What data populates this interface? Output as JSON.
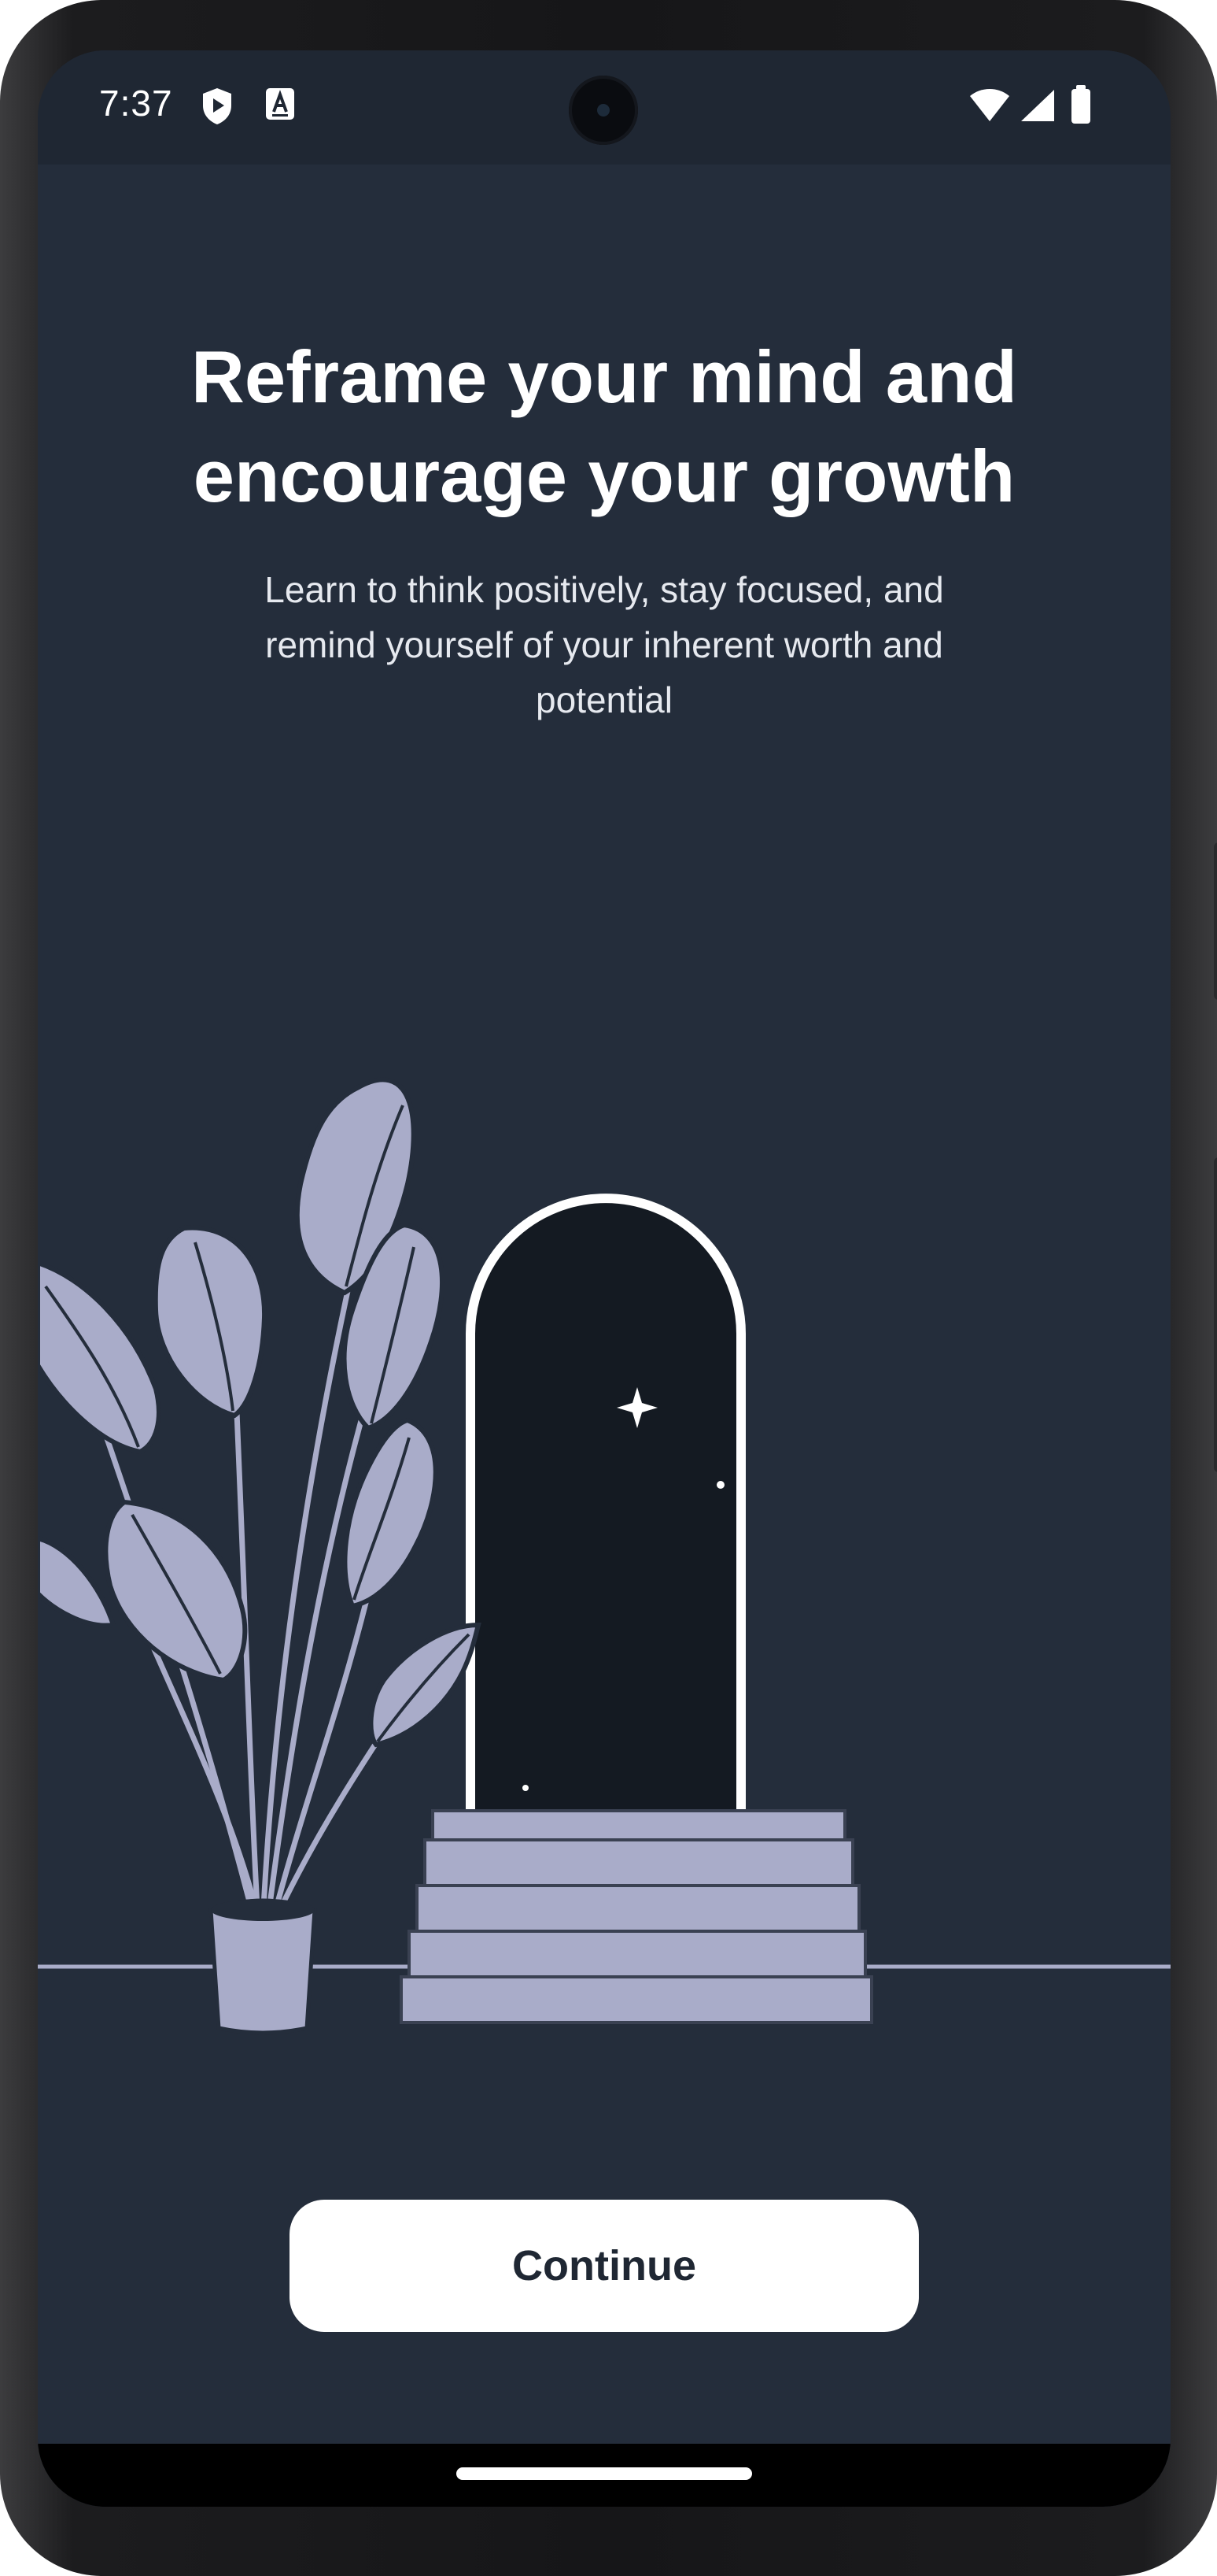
{
  "status_bar": {
    "time": "7:37",
    "left_icons": [
      "play-protect-icon",
      "accessibility-a-icon"
    ],
    "right_icons": [
      "wifi-icon",
      "cell-signal-icon",
      "battery-icon"
    ]
  },
  "onboarding": {
    "title": "Reframe your mind and encourage your growth",
    "subtitle": "Learn to think positively, stay focused, and remind yourself of your inherent worth and potential",
    "illustration": "plant-and-doorway-illustration",
    "continue_label": "Continue"
  },
  "colors": {
    "background": "#242d3b",
    "status_bar": "#1f2733",
    "illustration_fill": "#a9acc9",
    "doorway_dark": "#141a22",
    "button_bg": "#ffffff",
    "button_text": "#1f2733"
  }
}
